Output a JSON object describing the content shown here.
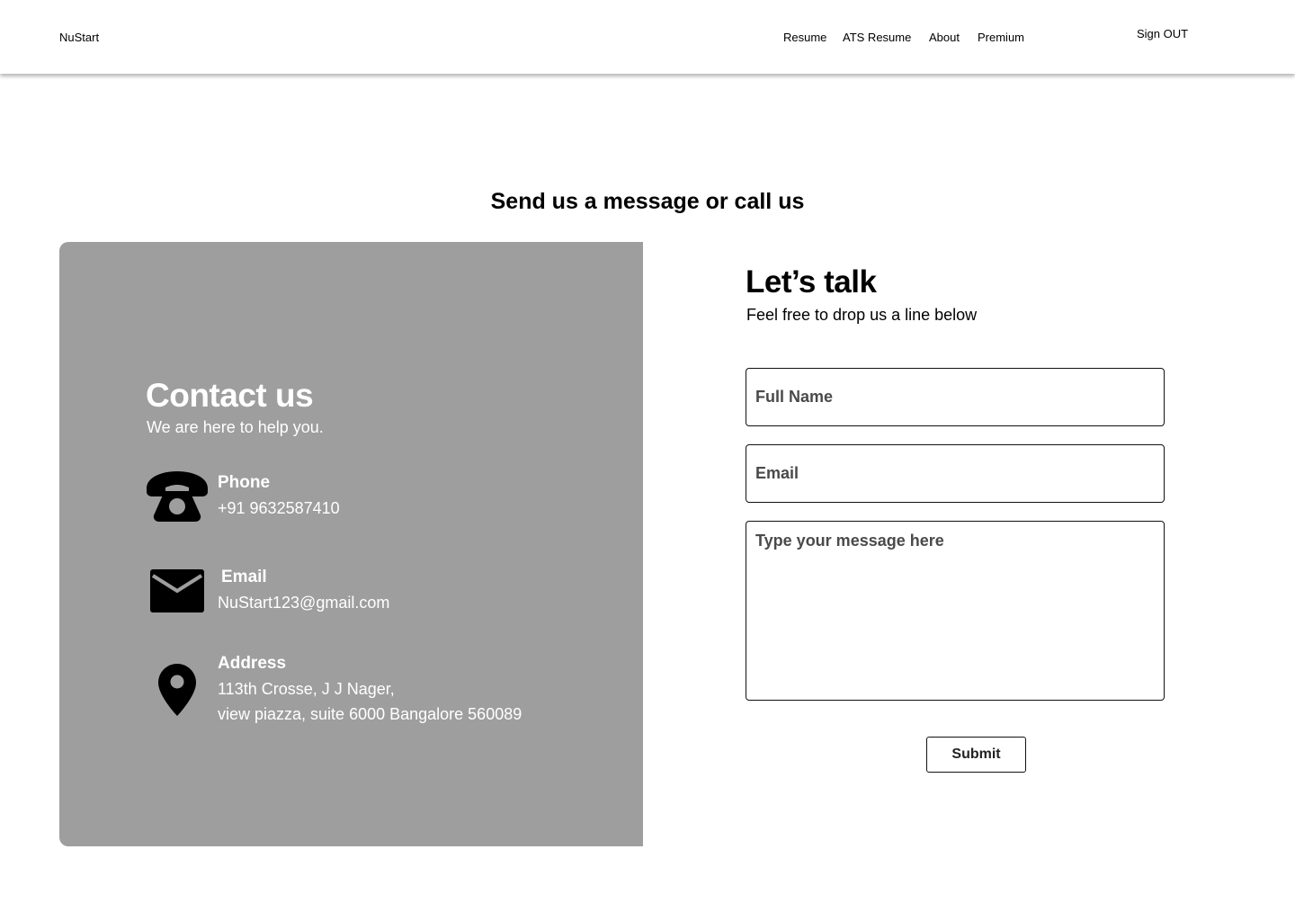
{
  "nav": {
    "brand": "NuStart",
    "links": [
      "Resume",
      "ATS Resume",
      "About",
      "Premium"
    ],
    "sign_out": "Sign OUT"
  },
  "page": {
    "section_title": "Send us a message or call us"
  },
  "contact": {
    "title": "Contact us",
    "subtitle": "We are here to help you.",
    "phone": {
      "label": "Phone",
      "value": "+91 9632587410",
      "icon": "phone-icon"
    },
    "email": {
      "label": "Email",
      "value": "NuStart123@gmail.com",
      "icon": "mail-icon"
    },
    "address": {
      "label": "Address",
      "line1": "113th Crosse, J J Nager,",
      "line2": "view piazza, suite 6000 Bangalore 560089",
      "icon": "location-pin-icon"
    },
    "panel_color": "#9e9e9e"
  },
  "form": {
    "title": "Let’s talk",
    "subtitle": "Feel free to drop us a line below",
    "full_name_placeholder": "Full Name",
    "email_placeholder": "Email",
    "message_placeholder": "Type your message here",
    "submit_label": "Submit"
  }
}
